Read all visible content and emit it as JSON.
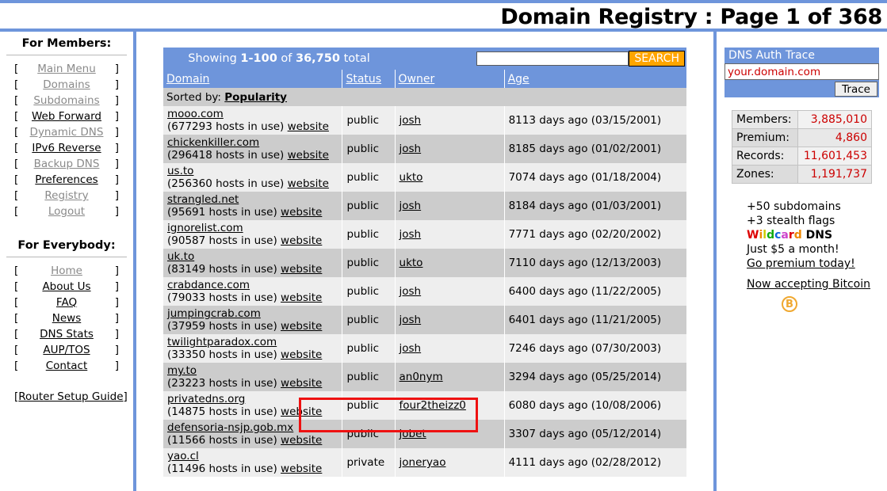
{
  "header": {
    "title": "Domain Registry : Page 1 of 368"
  },
  "sidebar_left": {
    "members_heading": "For Members:",
    "members_items": [
      {
        "label": "Main Menu",
        "dim": true
      },
      {
        "label": "Domains",
        "dim": true
      },
      {
        "label": "Subdomains",
        "dim": true
      },
      {
        "label": "Web Forward",
        "dim": false
      },
      {
        "label": "Dynamic DNS",
        "dim": true
      },
      {
        "label": "IPv6 Reverse",
        "dim": false
      },
      {
        "label": "Backup DNS",
        "dim": true
      },
      {
        "label": "Preferences",
        "dim": false
      },
      {
        "label": "Registry",
        "dim": true
      },
      {
        "label": "Logout",
        "dim": true
      }
    ],
    "everybody_heading": "For Everybody:",
    "everybody_items": [
      {
        "label": "Home",
        "dim": true
      },
      {
        "label": "About Us",
        "dim": false
      },
      {
        "label": "FAQ",
        "dim": false
      },
      {
        "label": "News",
        "dim": false
      },
      {
        "label": "DNS Stats",
        "dim": false
      },
      {
        "label": "AUP/TOS",
        "dim": false
      },
      {
        "label": "Contact",
        "dim": false
      }
    ],
    "router_guide": "Router Setup Guide",
    "bracket_open": "[",
    "bracket_close": "]"
  },
  "main": {
    "showing_prefix": "Showing ",
    "showing_range": "1-100",
    "showing_mid": " of ",
    "showing_total": "36,750",
    "showing_suffix": " total",
    "search_value": "",
    "search_placeholder": "",
    "search_button": "SEARCH",
    "columns": [
      "Domain",
      "Status",
      "Owner",
      "Age"
    ],
    "sorted_label": "Sorted by: ",
    "sorted_value": "Popularity",
    "website_label": "website",
    "rows": [
      {
        "domain": "mooo.com",
        "hosts": "(677293 hosts in use)",
        "status": "public",
        "owner": "josh",
        "age": "8113 days ago (03/15/2001)"
      },
      {
        "domain": "chickenkiller.com",
        "hosts": "(296418 hosts in use)",
        "status": "public",
        "owner": "josh",
        "age": "8185 days ago (01/02/2001)"
      },
      {
        "domain": "us.to",
        "hosts": "(256360 hosts in use)",
        "status": "public",
        "owner": "ukto",
        "age": "7074 days ago (01/18/2004)"
      },
      {
        "domain": "strangled.net",
        "hosts": "(95691 hosts in use)",
        "status": "public",
        "owner": "josh",
        "age": "8184 days ago (01/03/2001)"
      },
      {
        "domain": "ignorelist.com",
        "hosts": "(90587 hosts in use)",
        "status": "public",
        "owner": "josh",
        "age": "7771 days ago (02/20/2002)"
      },
      {
        "domain": "uk.to",
        "hosts": "(83149 hosts in use)",
        "status": "public",
        "owner": "ukto",
        "age": "7110 days ago (12/13/2003)"
      },
      {
        "domain": "crabdance.com",
        "hosts": "(79033 hosts in use)",
        "status": "public",
        "owner": "josh",
        "age": "6400 days ago (11/22/2005)"
      },
      {
        "domain": "jumpingcrab.com",
        "hosts": "(37959 hosts in use)",
        "status": "public",
        "owner": "josh",
        "age": "6401 days ago (11/21/2005)"
      },
      {
        "domain": "twilightparadox.com",
        "hosts": "(33350 hosts in use)",
        "status": "public",
        "owner": "josh",
        "age": "7246 days ago (07/30/2003)"
      },
      {
        "domain": "my.to",
        "hosts": "(23223 hosts in use)",
        "status": "public",
        "owner": "an0nym",
        "age": "3294 days ago (05/25/2014)"
      },
      {
        "domain": "privatedns.org",
        "hosts": "(14875 hosts in use)",
        "status": "public",
        "owner": "four2theizz0",
        "age": "6080 days ago (10/08/2006)"
      },
      {
        "domain": "defensoria-nsjp.gob.mx",
        "hosts": "(11566 hosts in use)",
        "status": "public",
        "owner": "jobet",
        "age": "3307 days ago (05/12/2014)"
      },
      {
        "domain": "yao.cl",
        "hosts": "(11496 hosts in use)",
        "status": "private",
        "owner": "joneryao",
        "age": "4111 days ago (02/28/2012)"
      }
    ],
    "highlight": {
      "row_domain": "my.to",
      "color": "#ee1111"
    }
  },
  "sidebar_right": {
    "trace_title": "DNS Auth Trace",
    "trace_value": "your.domain.com",
    "trace_button": "Trace",
    "stats": [
      {
        "key": "Members:",
        "value": "3,885,010"
      },
      {
        "key": "Premium:",
        "value": "4,860"
      },
      {
        "key": "Records:",
        "value": "11,601,453"
      },
      {
        "key": "Zones:",
        "value": "1,191,737"
      }
    ],
    "promo_line1": "+50 subdomains",
    "promo_line2": "+3 stealth flags",
    "wildcard_letters": [
      {
        "ch": "W",
        "color": "#dd0000"
      },
      {
        "ch": "i",
        "color": "#ee8800"
      },
      {
        "ch": "l",
        "color": "#cccc00"
      },
      {
        "ch": "d",
        "color": "#11aa11"
      },
      {
        "ch": "c",
        "color": "#1166dd"
      },
      {
        "ch": "a",
        "color": "#cc44cc"
      },
      {
        "ch": "r",
        "color": "#dd0000"
      },
      {
        "ch": "d",
        "color": "#ee8800"
      }
    ],
    "promo_dns": " DNS",
    "promo_price": "Just $5 a month!",
    "promo_link": "Go premium today!",
    "bitcoin_link": "Now accepting Bitcoin",
    "bitcoin_glyph": "B"
  },
  "colors": {
    "brand_blue": "#6e95db",
    "accent_orange": "#ffa500",
    "stat_red": "#cc0000",
    "row_odd": "#eeeeee",
    "row_even": "#cccccc"
  }
}
